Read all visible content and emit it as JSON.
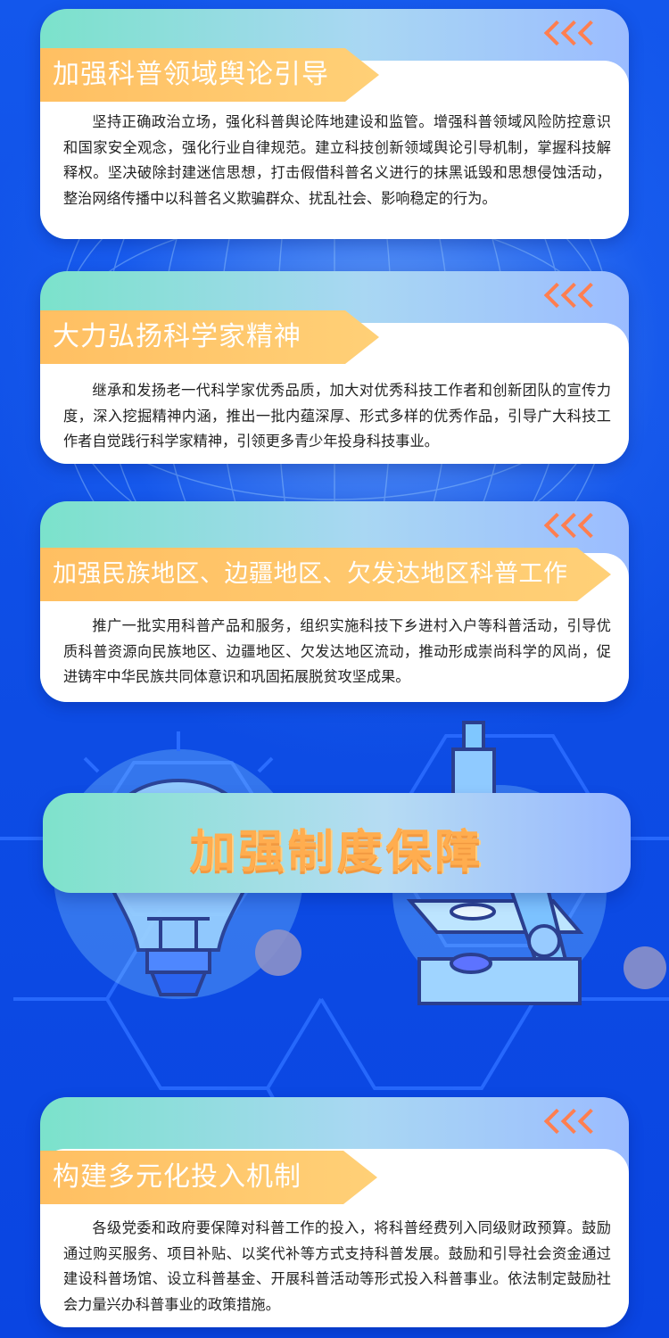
{
  "sections": [
    {
      "title": "加强科普领域舆论引导",
      "body": "坚持正确政治立场，强化科普舆论阵地建设和监管。增强科普领域风险防控意识和国家安全观念，强化行业自律规范。建立科技创新领域舆论引导机制，掌握科技解释权。坚决破除封建迷信思想，打击假借科普名义进行的抹黑诋毁和思想侵蚀活动，整治网络传播中以科普名义欺骗群众、扰乱社会、影响稳定的行为。"
    },
    {
      "title": "大力弘扬科学家精神",
      "body": "继承和发扬老一代科学家优秀品质，加大对优秀科技工作者和创新团队的宣传力度，深入挖掘精神内涵，推出一批内蕴深厚、形式多样的优秀作品，引导广大科技工作者自觉践行科学家精神，引领更多青少年投身科技事业。"
    },
    {
      "title": "加强民族地区、边疆地区、欠发达地区科普工作",
      "body": "推广一批实用科普产品和服务，组织实施科技下乡进村入户等科普活动，引导优质科普资源向民族地区、边疆地区、欠发达地区流动，推动形成崇尚科学的风尚，促进铸牢中华民族共同体意识和巩固拓展脱贫攻坚成果。"
    },
    {
      "title": "构建多元化投入机制",
      "body": "各级党委和政府要保障对科普工作的投入，将科普经费列入同级财政预算。鼓励通过购买服务、项目补贴、以奖代补等方式支持科普发展。鼓励和引导社会资金通过建设科普场馆、设立科普基金、开展科普活动等形式投入科普事业。依法制定鼓励社会力量兴办科普事业的政策措施。"
    }
  ],
  "banner": {
    "title": "加强制度保障"
  },
  "icons": {
    "chevrons": "triple-chevron-left-icon",
    "bulb": "light-bulb-icon",
    "microscope": "microscope-icon"
  },
  "colors": {
    "background": "#0b4ae6",
    "pill": "#ffbf62",
    "chevron": "#ff7e4f",
    "banner_text": "#ffad4f"
  }
}
